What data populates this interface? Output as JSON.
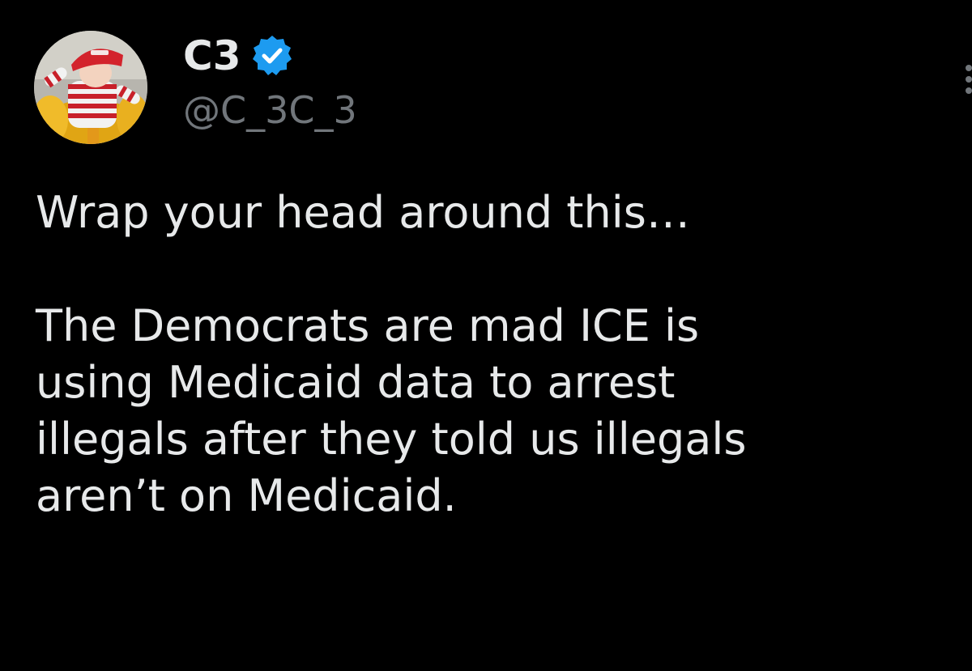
{
  "tweet": {
    "display_name": "C3",
    "handle": "@C_3C_3",
    "verified": true,
    "paragraphs": [
      "Wrap your head around this…",
      "The Democrats are mad ICE is\nusing Medicaid data to arrest\nillegals after they told us illegals\naren’t on Medicaid."
    ]
  },
  "icons": {
    "verified": "verified-badge-icon",
    "more": "more-options-icon"
  },
  "colors": {
    "background": "#000000",
    "primary_text": "#e7e9ea",
    "secondary_text": "#71767b",
    "verified_blue": "#1d9bf0"
  }
}
